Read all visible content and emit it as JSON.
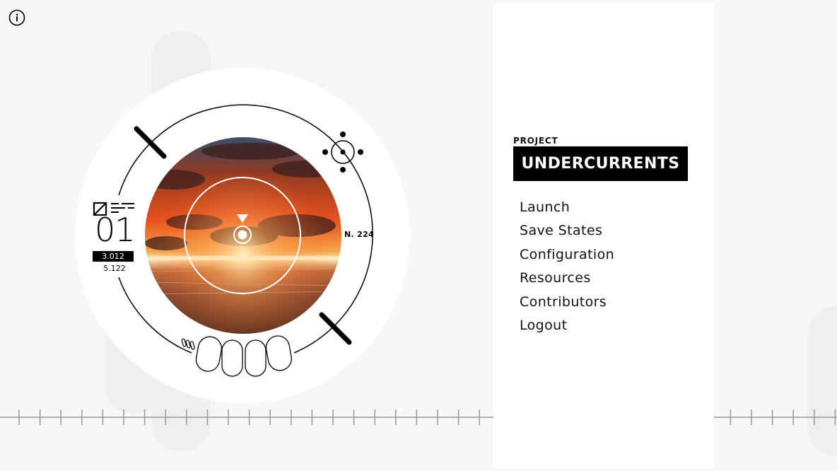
{
  "icons": {
    "info": "info-icon",
    "crosshair": "crosshair-icon",
    "diagonal_box": "crossed-square-icon",
    "text_lines": "text-lines-icon"
  },
  "dial": {
    "index": "01",
    "value_primary": "3.012",
    "value_secondary": "5.122",
    "reading": "N. 224"
  },
  "menu": {
    "project_label": "PROJECT",
    "title": "UNDERCURRENTS",
    "items": [
      {
        "label": "Launch"
      },
      {
        "label": "Save States"
      },
      {
        "label": "Configuration"
      },
      {
        "label": "Resources"
      },
      {
        "label": "Contributors"
      },
      {
        "label": "Logout"
      }
    ]
  },
  "colors": {
    "background": "#f7f7f7",
    "panel": "#ffffff",
    "ink": "#000000",
    "sky_orange": "#e8501c",
    "sea_brown": "#6a3e2a"
  }
}
